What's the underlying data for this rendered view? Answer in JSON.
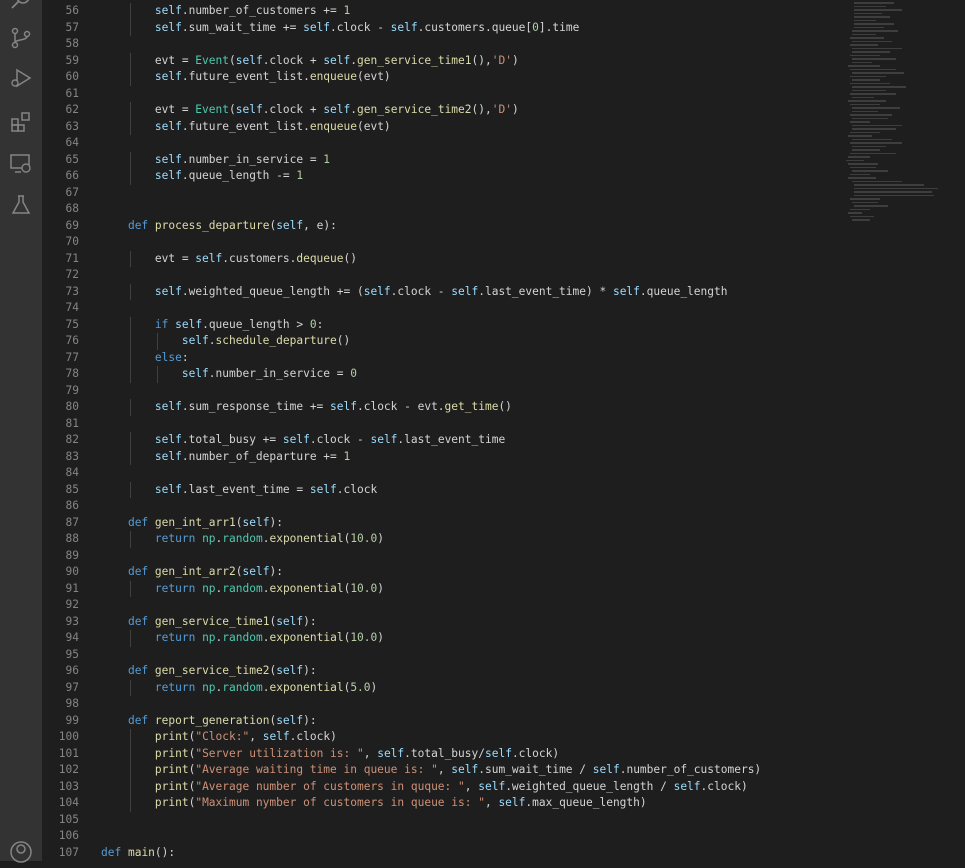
{
  "activity_bar": {
    "icons": [
      "search-icon",
      "source-control-icon",
      "run-debug-icon",
      "extensions-icon",
      "remote-explorer-icon",
      "testing-icon",
      "account-icon"
    ]
  },
  "editor": {
    "lines": [
      {
        "n": "56",
        "t": "        self.number_of_customers += 1"
      },
      {
        "n": "57",
        "t": "        self.sum_wait_time += self.clock - self.customers.queue[0].time"
      },
      {
        "n": "58",
        "t": ""
      },
      {
        "n": "59",
        "t": "        evt = Event(self.clock + self.gen_service_time1(),'D')"
      },
      {
        "n": "60",
        "t": "        self.future_event_list.enqueue(evt)"
      },
      {
        "n": "61",
        "t": ""
      },
      {
        "n": "62",
        "t": "        evt = Event(self.clock + self.gen_service_time2(),'D')"
      },
      {
        "n": "63",
        "t": "        self.future_event_list.enqueue(evt)"
      },
      {
        "n": "64",
        "t": ""
      },
      {
        "n": "65",
        "t": "        self.number_in_service = 1"
      },
      {
        "n": "66",
        "t": "        self.queue_length -= 1"
      },
      {
        "n": "67",
        "t": ""
      },
      {
        "n": "68",
        "t": ""
      },
      {
        "n": "69",
        "t": "    def process_departure(self, e):"
      },
      {
        "n": "70",
        "t": ""
      },
      {
        "n": "71",
        "t": "        evt = self.customers.dequeue()"
      },
      {
        "n": "72",
        "t": ""
      },
      {
        "n": "73",
        "t": "        self.weighted_queue_length += (self.clock - self.last_event_time) * self.queue_length"
      },
      {
        "n": "74",
        "t": ""
      },
      {
        "n": "75",
        "t": "        if self.queue_length > 0:"
      },
      {
        "n": "76",
        "t": "            self.schedule_departure()"
      },
      {
        "n": "77",
        "t": "        else:"
      },
      {
        "n": "78",
        "t": "            self.number_in_service = 0"
      },
      {
        "n": "79",
        "t": ""
      },
      {
        "n": "80",
        "t": "        self.sum_response_time += self.clock - evt.get_time()"
      },
      {
        "n": "81",
        "t": ""
      },
      {
        "n": "82",
        "t": "        self.total_busy += self.clock - self.last_event_time"
      },
      {
        "n": "83",
        "t": "        self.number_of_departure += 1"
      },
      {
        "n": "84",
        "t": ""
      },
      {
        "n": "85",
        "t": "        self.last_event_time = self.clock"
      },
      {
        "n": "86",
        "t": ""
      },
      {
        "n": "87",
        "t": "    def gen_int_arr1(self):"
      },
      {
        "n": "88",
        "t": "        return np.random.exponential(10.0)"
      },
      {
        "n": "89",
        "t": ""
      },
      {
        "n": "90",
        "t": "    def gen_int_arr2(self):"
      },
      {
        "n": "91",
        "t": "        return np.random.exponential(10.0)"
      },
      {
        "n": "92",
        "t": ""
      },
      {
        "n": "93",
        "t": "    def gen_service_time1(self):"
      },
      {
        "n": "94",
        "t": "        return np.random.exponential(10.0)"
      },
      {
        "n": "95",
        "t": ""
      },
      {
        "n": "96",
        "t": "    def gen_service_time2(self):"
      },
      {
        "n": "97",
        "t": "        return np.random.exponential(5.0)"
      },
      {
        "n": "98",
        "t": ""
      },
      {
        "n": "99",
        "t": "    def report_generation(self):"
      },
      {
        "n": "100",
        "t": "        print(\"Clock:\", self.clock)"
      },
      {
        "n": "101",
        "t": "        print(\"Server utilization is: \", self.total_busy/self.clock)"
      },
      {
        "n": "102",
        "t": "        print(\"Average waiting time in queue is: \", self.sum_wait_time / self.number_of_customers)"
      },
      {
        "n": "103",
        "t": "        print(\"Average number of customers in quque: \", self.weighted_queue_length / self.clock)"
      },
      {
        "n": "104",
        "t": "        print(\"Maximum nymber of customers in queue is: \", self.max_queue_length)"
      },
      {
        "n": "105",
        "t": ""
      },
      {
        "n": "106",
        "t": ""
      },
      {
        "n": "107",
        "t": "def main():"
      }
    ]
  },
  "colors": {
    "background": "#1e1e1e",
    "activity_bar": "#333333",
    "keyword": "#569cd6",
    "function": "#dcdcaa",
    "string": "#ce9178",
    "number": "#b5cea8",
    "class": "#4ec9b0",
    "variable": "#9cdcfe"
  }
}
